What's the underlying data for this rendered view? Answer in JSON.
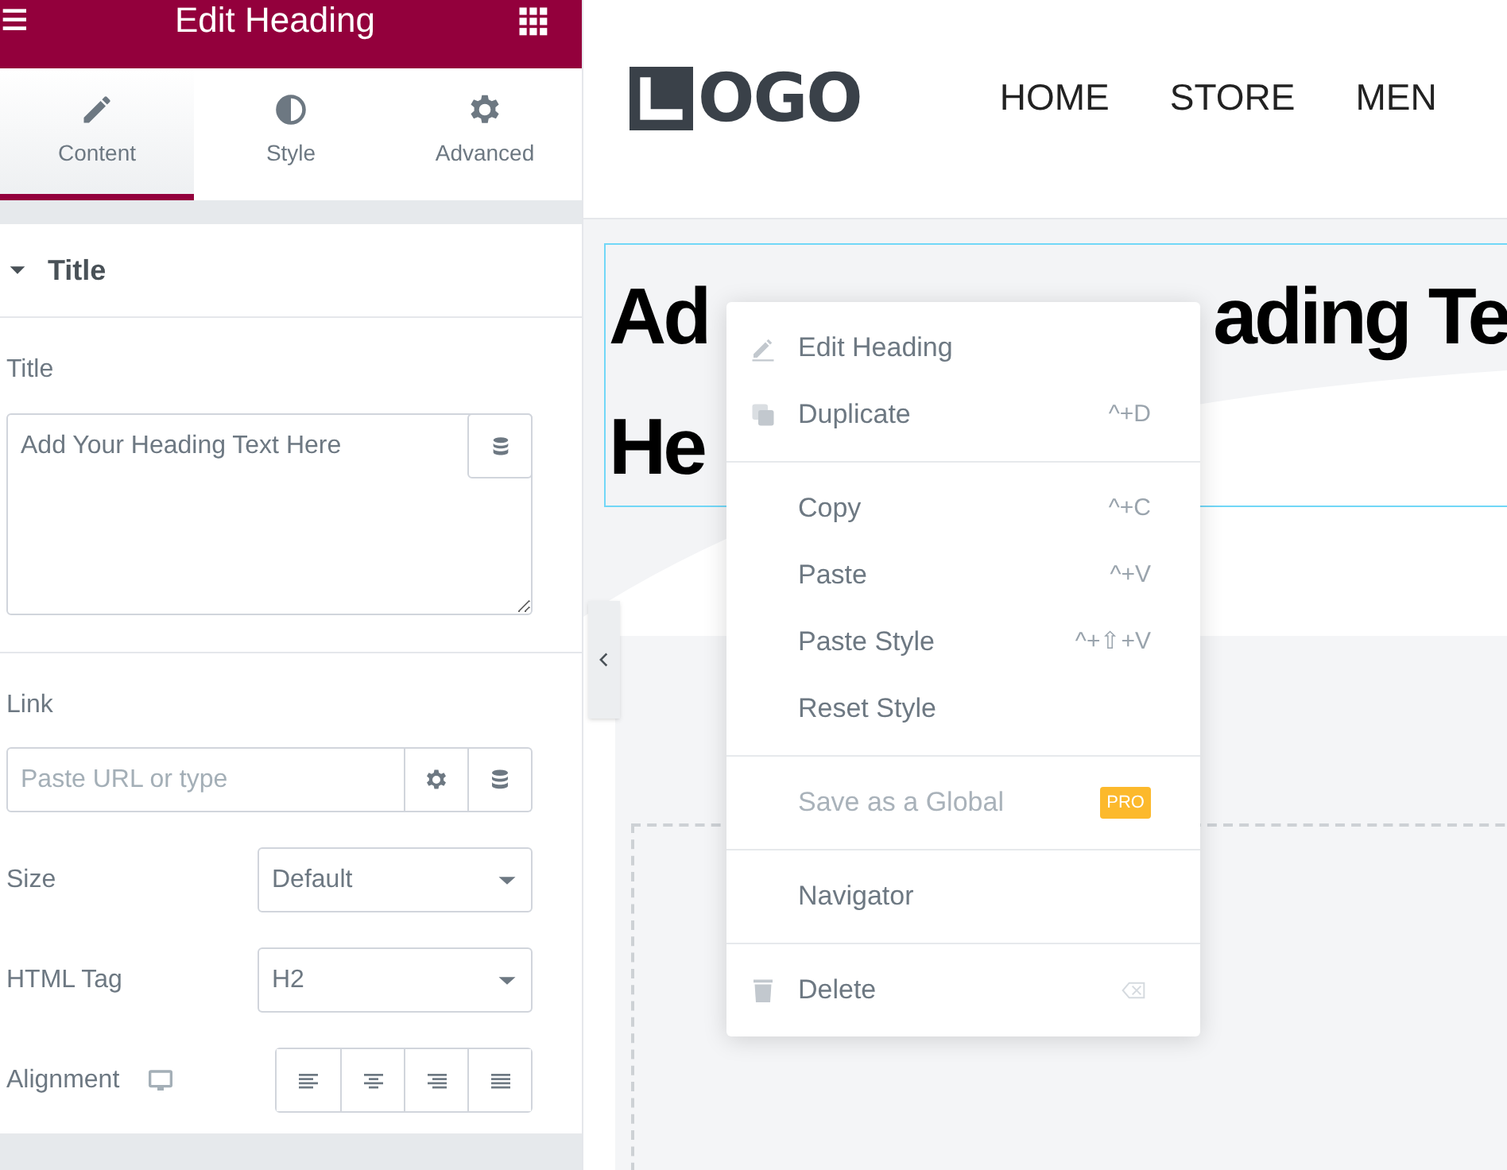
{
  "panel": {
    "title": "Edit Heading",
    "tabs": [
      {
        "label": "Content",
        "kind": "pencil",
        "selected": true
      },
      {
        "label": "Style",
        "kind": "contrast",
        "selected": false
      },
      {
        "label": "Advanced",
        "kind": "gear",
        "selected": false
      }
    ],
    "section": {
      "title": "Title",
      "expanded": true
    },
    "title_field": {
      "label": "Title",
      "value": "Add Your Heading Text Here"
    },
    "link_field": {
      "label": "Link",
      "placeholder": "Paste URL or type"
    },
    "size": {
      "label": "Size",
      "value": "Default"
    },
    "html_tag": {
      "label": "HTML Tag",
      "value": "H2"
    },
    "alignment": {
      "label": "Alignment",
      "options": [
        {
          "kind": "left",
          "selected": false
        },
        {
          "kind": "center",
          "selected": false
        },
        {
          "kind": "right",
          "selected": false
        },
        {
          "kind": "justify",
          "selected": false
        }
      ]
    }
  },
  "preview": {
    "nav": [
      "HOME",
      "STORE",
      "MEN"
    ],
    "logo": "OGO",
    "heading_lines": [
      [
        "Ad",
        "ading Te"
      ],
      [
        "He"
      ]
    ]
  },
  "context_menu": {
    "groups": [
      [
        {
          "kind": "edit",
          "label": "Edit Heading",
          "disabled": false
        },
        {
          "kind": "duplicate",
          "label": "Duplicate",
          "shortcut": "^+D",
          "disabled": false
        }
      ],
      [
        {
          "kind": "plain",
          "label": "Copy",
          "shortcut": "^+C",
          "disabled": false
        },
        {
          "kind": "plain",
          "label": "Paste",
          "shortcut": "^+V",
          "disabled": false
        },
        {
          "kind": "plain",
          "label": "Paste Style",
          "shortcut": "^+⇧+V",
          "disabled": false
        },
        {
          "kind": "plain",
          "label": "Reset Style",
          "disabled": false
        }
      ],
      [
        {
          "kind": "plain",
          "label": "Save as a Global",
          "badge": "PRO",
          "disabled": true
        }
      ],
      [
        {
          "kind": "plain",
          "label": "Navigator",
          "disabled": false
        }
      ],
      [
        {
          "kind": "delete",
          "label": "Delete",
          "disabled": false
        }
      ]
    ]
  }
}
